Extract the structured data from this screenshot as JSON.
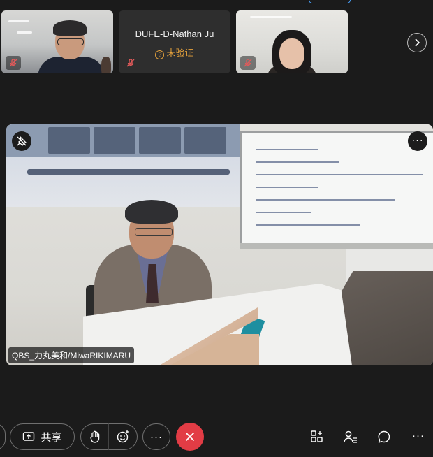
{
  "participants": [
    {
      "name": "",
      "verified_label": "",
      "muted": true
    },
    {
      "name": "DUFE-D-Nathan Ju",
      "verified_label": "未验证",
      "muted": true
    },
    {
      "name": "",
      "verified_label": "",
      "muted": true
    }
  ],
  "main_video": {
    "speaker_name": "QBS_力丸美和/MiwaRIKIMARU",
    "more_label": "···"
  },
  "toolbar": {
    "share_label": "共享",
    "more_label": "···",
    "right_more_label": "···"
  },
  "icons": {
    "mic_off": "mic-off-icon",
    "next": "chevron-right-icon",
    "unpin": "pin-off-icon",
    "share": "share-screen-icon",
    "raise_hand": "raise-hand-icon",
    "reactions": "reactions-icon",
    "end_call": "close-icon",
    "apps": "apps-icon",
    "participants": "participants-icon",
    "chat": "chat-icon"
  },
  "colors": {
    "background": "#1b1b1b",
    "end_call": "#e23c45",
    "unverified": "#e6a23c",
    "active_indicator": "#4aa3ff"
  }
}
